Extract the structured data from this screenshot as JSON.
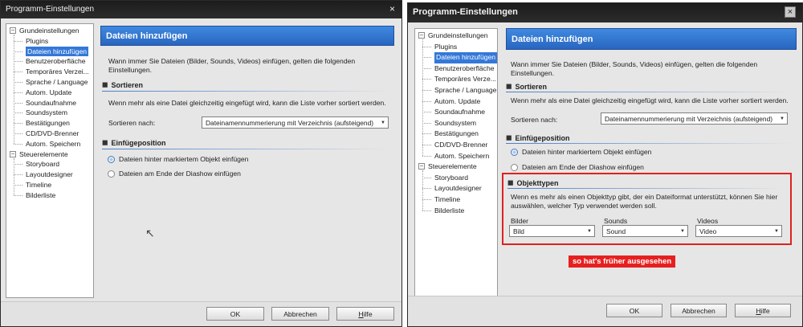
{
  "left": {
    "title": "Programm-Einstellungen",
    "close": "×",
    "tree": [
      {
        "label": "Grundeinstellungen",
        "level": 0,
        "expander": "−"
      },
      {
        "label": "Plugins",
        "level": 1
      },
      {
        "label": "Dateien hinzufügen",
        "level": 1,
        "selected": true
      },
      {
        "label": "Benutzeroberfläche",
        "level": 1
      },
      {
        "label": "Temporäres Verzei...",
        "level": 1
      },
      {
        "label": "Sprache / Language",
        "level": 1
      },
      {
        "label": "Autom. Update",
        "level": 1
      },
      {
        "label": "Soundaufnahme",
        "level": 1
      },
      {
        "label": "Soundsystem",
        "level": 1
      },
      {
        "label": "Bestätigungen",
        "level": 1
      },
      {
        "label": "CD/DVD-Brenner",
        "level": 1
      },
      {
        "label": "Autom. Speichern",
        "level": 1
      },
      {
        "label": "Steuerelemente",
        "level": 0,
        "expander": "−"
      },
      {
        "label": "Storyboard",
        "level": 1
      },
      {
        "label": "Layoutdesigner",
        "level": 1
      },
      {
        "label": "Timeline",
        "level": 1
      },
      {
        "label": "Bilderliste",
        "level": 1
      }
    ],
    "header": "Dateien hinzufügen",
    "intro": "Wann immer Sie Dateien (Bilder, Sounds, Videos) einfügen, gelten die folgenden Einstellungen.",
    "sort_section": "Sortieren",
    "sort_text": "Wenn mehr als eine Datei gleichzeitig eingefügt wird, kann die Liste vorher sortiert werden.",
    "sort_label": "Sortieren nach:",
    "sort_value": "Dateinamennummerierung mit Verzeichnis (aufsteigend)",
    "insert_section": "Einfügeposition",
    "radio1": "Dateien hinter markiertem Objekt einfügen",
    "radio2": "Dateien am Ende der Diashow einfügen",
    "ok": "OK",
    "cancel": "Abbrechen",
    "help_u": "H",
    "help_rest": "ilfe"
  },
  "right": {
    "title": "Programm-Einstellungen",
    "close": "×",
    "tree": [
      {
        "label": "Grundeinstellungen",
        "level": 0,
        "expander": "−"
      },
      {
        "label": "Plugins",
        "level": 1
      },
      {
        "label": "Dateien hinzufügen",
        "level": 1,
        "selected": true
      },
      {
        "label": "Benutzeroberfläche",
        "level": 1
      },
      {
        "label": "Temporäres Verze...",
        "level": 1
      },
      {
        "label": "Sprache / Language",
        "level": 1
      },
      {
        "label": "Autom. Update",
        "level": 1
      },
      {
        "label": "Soundaufnahme",
        "level": 1
      },
      {
        "label": "Soundsystem",
        "level": 1
      },
      {
        "label": "Bestätigungen",
        "level": 1
      },
      {
        "label": "CD/DVD-Brenner",
        "level": 1
      },
      {
        "label": "Autom. Speichern",
        "level": 1
      },
      {
        "label": "Steuerelemente",
        "level": 0,
        "expander": "−"
      },
      {
        "label": "Storyboard",
        "level": 1
      },
      {
        "label": "Layoutdesigner",
        "level": 1
      },
      {
        "label": "Timeline",
        "level": 1
      },
      {
        "label": "Bilderliste",
        "level": 1
      }
    ],
    "header": "Dateien hinzufügen",
    "intro": "Wann immer Sie Dateien (Bilder, Sounds, Videos) einfügen, gelten die folgenden Einstellungen.",
    "sort_section": "Sortieren",
    "sort_text": "Wenn mehr als eine Datei gleichzeitig eingefügt wird, kann die Liste vorher sortiert werden.",
    "sort_label": "Sortieren nach:",
    "sort_value": "Dateinamennummerierung mit Verzeichnis (aufsteigend)",
    "insert_section": "Einfügeposition",
    "radio1": "Dateien hinter markiertem Objekt einfügen",
    "radio2": "Dateien am Ende der Diashow einfügen",
    "types_section": "Objekttypen",
    "types_text": "Wenn es mehr als einen Objekttyp gibt, der ein Dateiformat unterstützt, können Sie hier auswählen, welcher Typ verwendet werden soll.",
    "col_images": "Bilder",
    "col_sounds": "Sounds",
    "col_videos": "Videos",
    "val_images": "Bild",
    "val_sounds": "Sound",
    "val_videos": "Video",
    "note": "so hat's früher ausgesehen",
    "ok": "OK",
    "cancel": "Abbrechen",
    "help_u": "H",
    "help_rest": "ilfe"
  },
  "colors": {
    "header_blue": "#3478d8",
    "highlight_red": "#e02020"
  }
}
